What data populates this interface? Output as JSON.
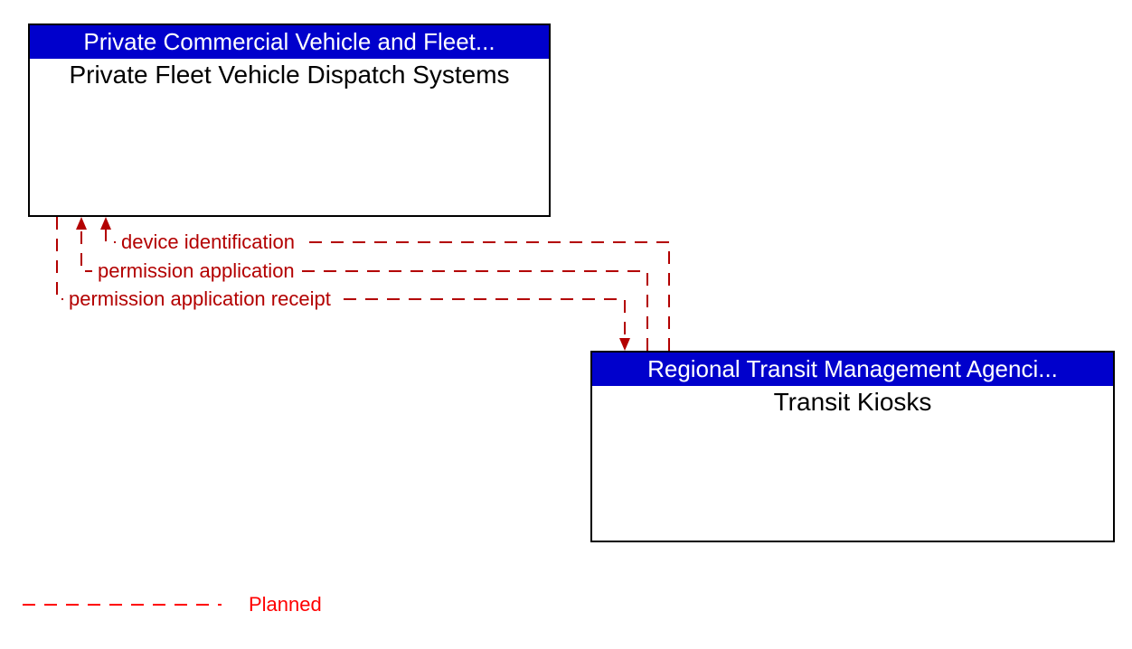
{
  "boxes": {
    "top": {
      "header": "Private Commercial Vehicle and Fleet...",
      "body": "Private Fleet Vehicle Dispatch Systems"
    },
    "bottom": {
      "header": "Regional Transit Management Agenci...",
      "body": "Transit Kiosks"
    }
  },
  "flows": {
    "f1": "device identification",
    "f2": "permission application",
    "f3": "permission application receipt"
  },
  "legend": {
    "planned": "Planned"
  }
}
